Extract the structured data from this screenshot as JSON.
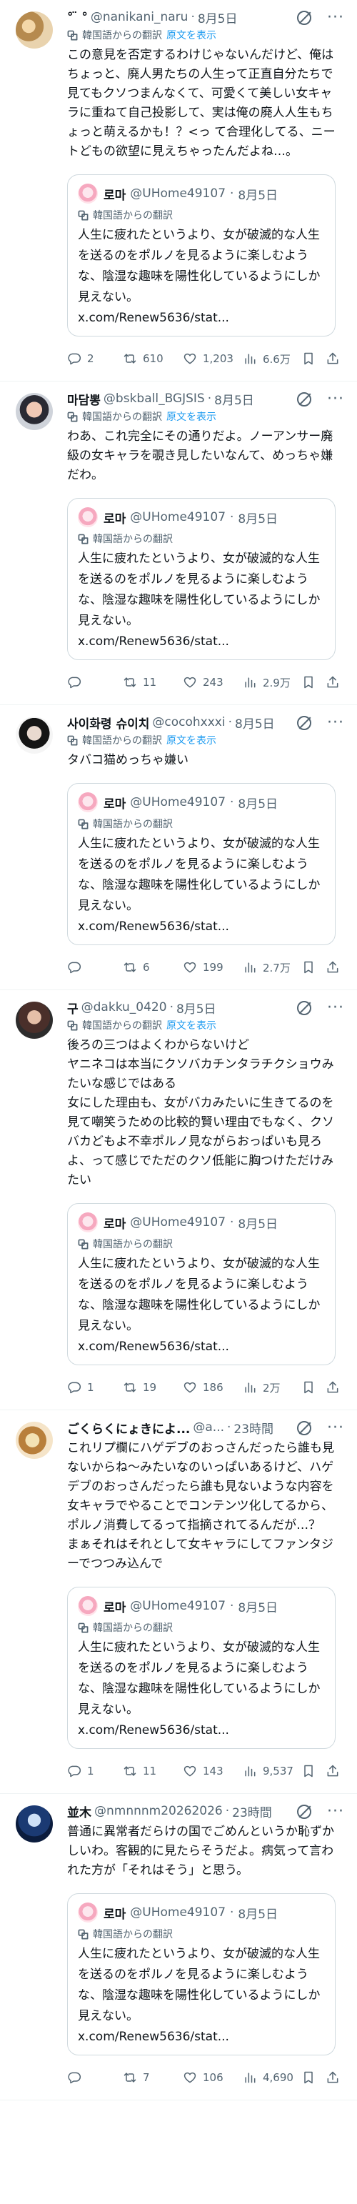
{
  "posts": [
    {
      "name": "° ̈ ° ",
      "handle": "@nanikani_naru",
      "time": "8月5日",
      "translated_from": "韓国語からの翻訳",
      "show_original": "原文を表示",
      "text": "この意見を否定するわけじゃないんだけど、俺はちょっと、廃人男たちの人生って正直自分たちで見てもクソつまんなくて、可愛くて美しい女キャラに重ねて自己投影して、実は俺の廃人人生もちょっと萌えるかも！？<っ て合理化してる、ニートどもの欲望に見えちゃったんだよね…。",
      "quote": {
        "name": "로마",
        "handle": "@UHome49107",
        "time": "8月5日",
        "translated_from": "韓国語からの翻訳",
        "text": "人生に疲れたというより、女が破滅的な人生を送るのをポルノを見るように楽しむような、陰湿な趣味を陽性化しているようにしか見えない。",
        "link": "x.com/Renew5636/stat..."
      },
      "stats": {
        "replies": "2",
        "reposts": "610",
        "likes": "1,203",
        "views": "6.6万"
      }
    },
    {
      "name": "마담뽕",
      "handle": "@bskball_BGJSIS",
      "time": "8月5日",
      "translated_from": "韓国語からの翻訳",
      "show_original": "原文を表示",
      "text": "わあ、これ完全にその通りだよ。ノーアンサー廃級の女キャラを覗き見したいなんて、めっちゃ嫌だわ。",
      "quote": {
        "name": "로마",
        "handle": "@UHome49107",
        "time": "8月5日",
        "translated_from": "韓国語からの翻訳",
        "text": "人生に疲れたというより、女が破滅的な人生を送るのをポルノを見るように楽しむような、陰湿な趣味を陽性化しているようにしか見えない。",
        "link": "x.com/Renew5636/stat..."
      },
      "stats": {
        "replies": "",
        "reposts": "11",
        "likes": "243",
        "views": "2.9万"
      }
    },
    {
      "name": "사이화령 슈이치",
      "handle": "@cocohxxxi",
      "time": "8月5日",
      "translated_from": "韓国語からの翻訳",
      "show_original": "原文を表示",
      "text": "タバコ猫めっちゃ嫌い",
      "quote": {
        "name": "로마",
        "handle": "@UHome49107",
        "time": "8月5日",
        "translated_from": "韓国語からの翻訳",
        "text": "人生に疲れたというより、女が破滅的な人生を送るのをポルノを見るように楽しむような、陰湿な趣味を陽性化しているようにしか見えない。",
        "link": "x.com/Renew5636/stat..."
      },
      "stats": {
        "replies": "",
        "reposts": "6",
        "likes": "199",
        "views": "2.7万"
      }
    },
    {
      "name": "구",
      "handle": "@dakku_0420",
      "time": "8月5日",
      "translated_from": "韓国語からの翻訳",
      "show_original": "原文を表示",
      "text": "後ろの三つはよくわからないけど\nヤニネコは本当にクソバカチンタラチクショウみたいな感じではある\n女にした理由も、女がバカみたいに生きてるのを見て嘲笑うための比較的賢い理由でもなく、クソバカどもよ不幸ポルノ見ながらおっぱいも見ろよ、って感じでただのクソ低能に胸つけただけみたい",
      "quote": {
        "name": "로마",
        "handle": "@UHome49107",
        "time": "8月5日",
        "translated_from": "韓国語からの翻訳",
        "text": "人生に疲れたというより、女が破滅的な人生を送るのをポルノを見るように楽しむような、陰湿な趣味を陽性化しているようにしか見えない。",
        "link": "x.com/Renew5636/stat..."
      },
      "stats": {
        "replies": "1",
        "reposts": "19",
        "likes": "186",
        "views": "2万"
      }
    },
    {
      "name": "ごくらくにょきによ...",
      "handle": "@a...",
      "time": "23時間",
      "translated_from": "",
      "show_original": "",
      "text": "これリプ欄にハゲデブのおっさんだったら誰も見ないからね〜みたいなのいっぱいあるけど、ハゲデブのおっさんだったら誰も見ないような内容を女キャラでやることでコンテンツ化してるから、ポルノ消費してるって指摘されてるんだが…？\nまぁそれはそれとして女キャラにしてファンタジーでつつみ込んで",
      "quote": {
        "name": "로마",
        "handle": "@UHome49107",
        "time": "8月5日",
        "translated_from": "韓国語からの翻訳",
        "text": "人生に疲れたというより、女が破滅的な人生を送るのをポルノを見るように楽しむような、陰湿な趣味を陽性化しているようにしか見えない。",
        "link": "x.com/Renew5636/stat..."
      },
      "stats": {
        "replies": "1",
        "reposts": "11",
        "likes": "143",
        "views": "9,537"
      }
    },
    {
      "name": "並木",
      "handle": "@nmnnnm20262026",
      "time": "23時間",
      "translated_from": "",
      "show_original": "",
      "text": "普通に異常者だらけの国でごめんというか恥ずかしいわ。客観的に見たらそうだよ。病気って言われた方が「それはそう」と思う。",
      "quote": {
        "name": "로마",
        "handle": "@UHome49107",
        "time": "8月5日",
        "translated_from": "韓国語からの翻訳",
        "text": "人生に疲れたというより、女が破滅的な人生を送るのをポルノを見るように楽しむような、陰湿な趣味を陽性化しているようにしか見えない。",
        "link": "x.com/Renew5636/stat..."
      },
      "stats": {
        "replies": "",
        "reposts": "7",
        "likes": "106",
        "views": "4,690"
      }
    }
  ]
}
